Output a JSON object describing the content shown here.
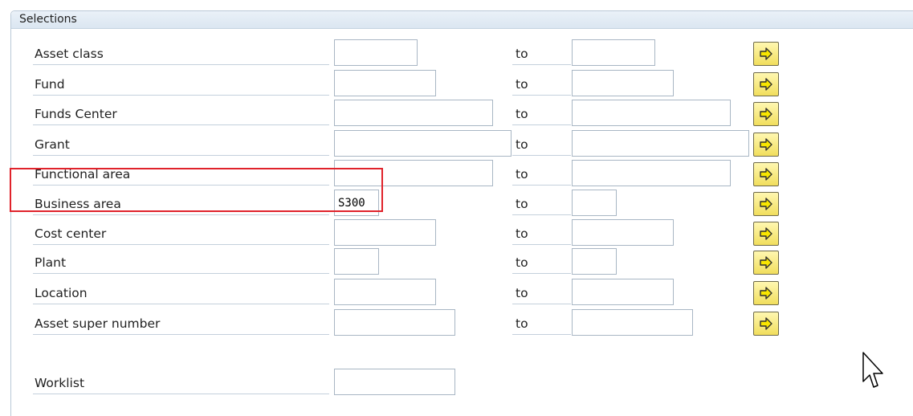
{
  "section": {
    "title": "Selections"
  },
  "to_label": "to",
  "rows": [
    {
      "label": "Asset class",
      "from": "",
      "to": ""
    },
    {
      "label": "Fund",
      "from": "",
      "to": ""
    },
    {
      "label": "Funds Center",
      "from": "",
      "to": ""
    },
    {
      "label": "Grant",
      "from": "",
      "to": ""
    },
    {
      "label": "Functional area",
      "from": "",
      "to": ""
    },
    {
      "label": "Business area",
      "from": "S300",
      "to": ""
    },
    {
      "label": "Cost center",
      "from": "",
      "to": ""
    },
    {
      "label": "Plant",
      "from": "",
      "to": ""
    },
    {
      "label": "Location",
      "from": "",
      "to": ""
    },
    {
      "label": "Asset super number",
      "from": "",
      "to": ""
    }
  ],
  "worklist": {
    "label": "Worklist",
    "value": ""
  },
  "icons": {
    "multiple_selection": "arrow-right-icon",
    "cursor": "mouse-pointer-icon"
  },
  "colors": {
    "highlight": "#e0232b",
    "button_fill": "#f1de5c",
    "header_bg": "#dbe6f1"
  }
}
